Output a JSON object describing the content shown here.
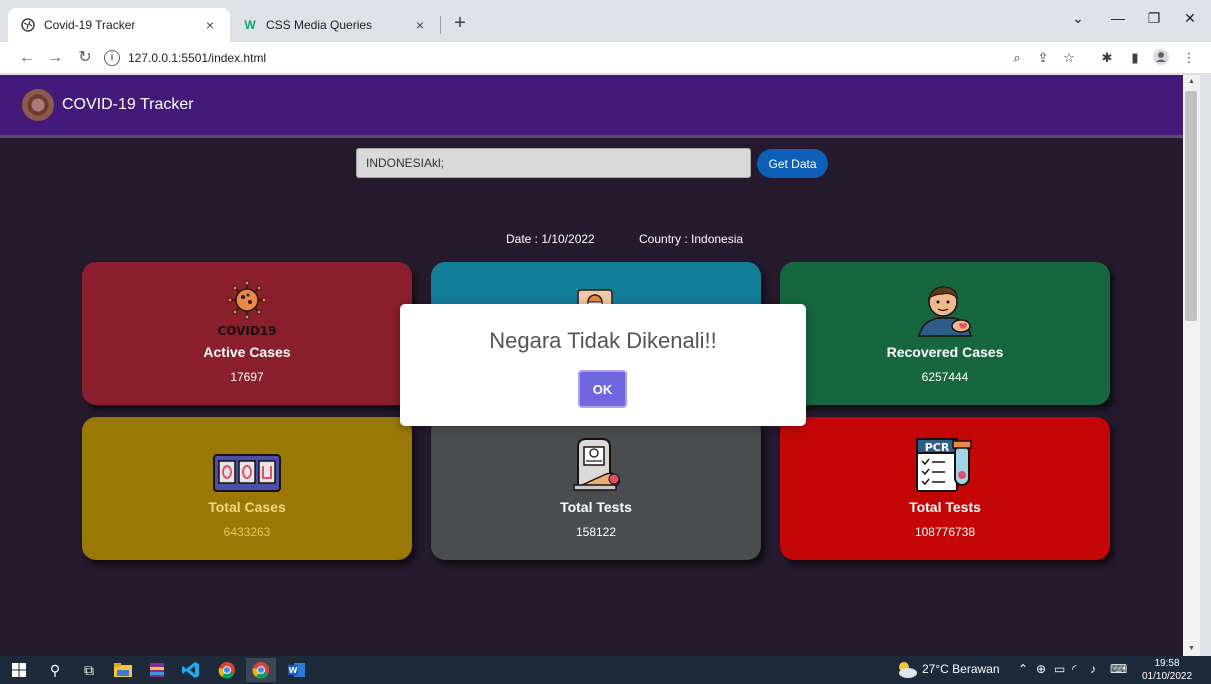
{
  "browser": {
    "tabs": [
      {
        "label": "Covid-19 Tracker",
        "close": "×"
      },
      {
        "label": "CSS Media Queries",
        "close": "×"
      }
    ],
    "new_tab": "+",
    "url": "127.0.0.1:5501/index.html"
  },
  "app": {
    "brand": "COVID-19 Tracker",
    "search": {
      "value": "INDONESIAkl;"
    },
    "get_data_label": "Get Data",
    "date_text": "Date : 1/10/2022",
    "country_text": "Country : Indonesia",
    "cards": [
      {
        "title": "Active Cases",
        "value": "17697"
      },
      {
        "title": "",
        "value": ""
      },
      {
        "title": "Recovered Cases",
        "value": "6257444"
      },
      {
        "title": "Total Cases",
        "value": "6433263"
      },
      {
        "title": "Total Tests",
        "value": "158122"
      },
      {
        "title": "Total Tests",
        "value": "108776738"
      }
    ],
    "covid_icon_text": "COVID19",
    "pcr_icon_text": "PCR"
  },
  "dialog": {
    "message": "Negara Tidak Dikenali!!",
    "ok_label": "OK"
  },
  "taskbar": {
    "weather": "27°C  Berawan",
    "time": "19:58",
    "date": "01/10/2022"
  }
}
